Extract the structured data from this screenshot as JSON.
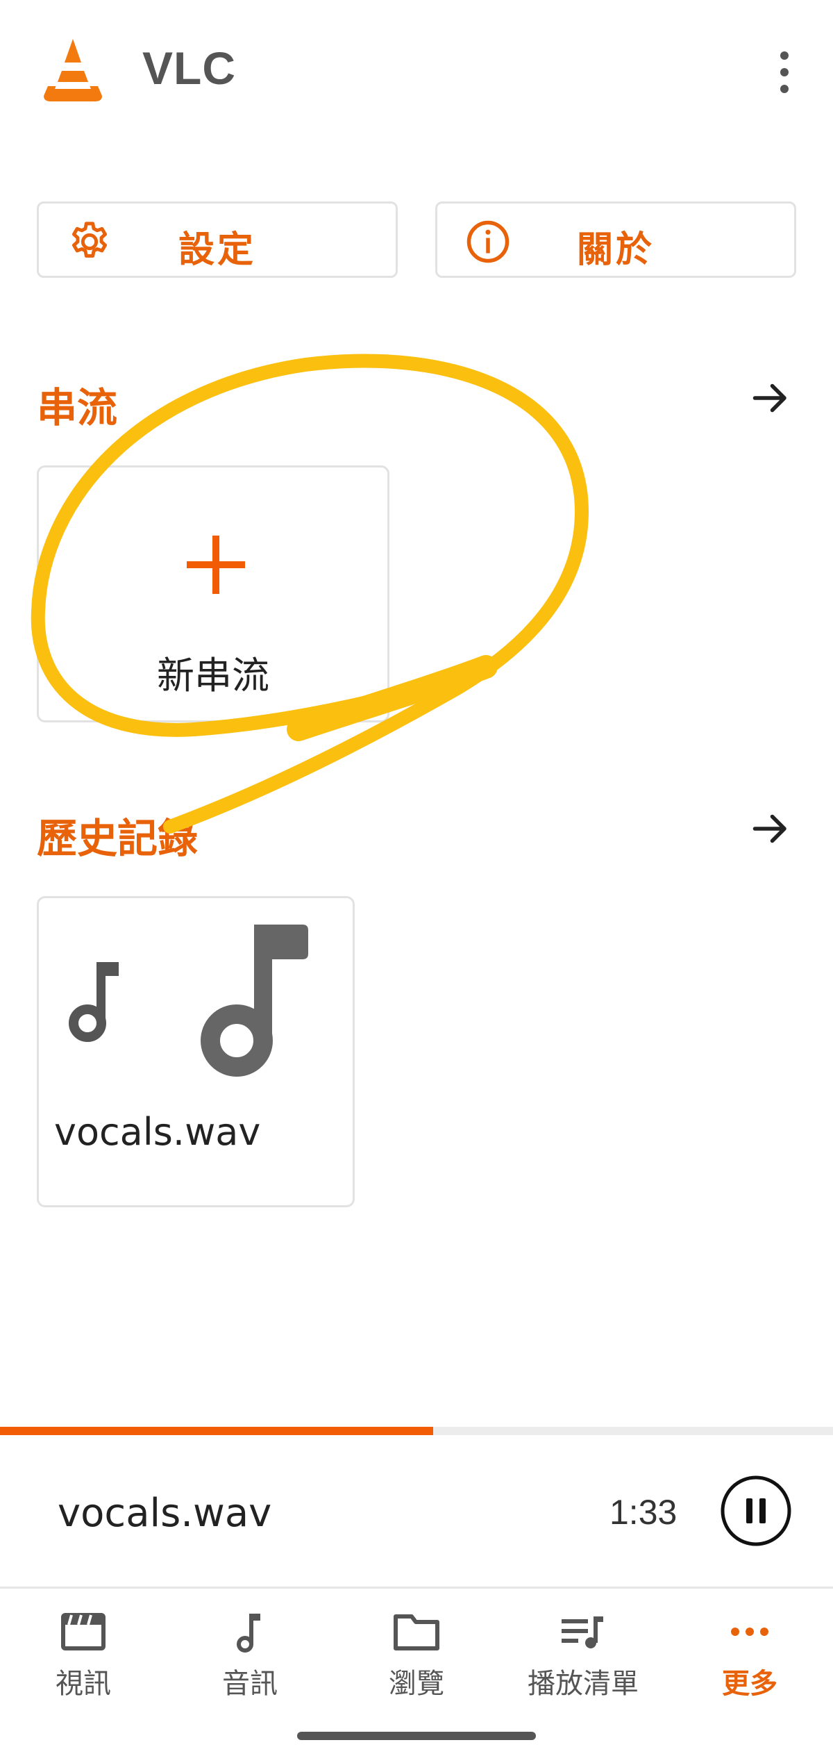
{
  "app": {
    "title": "VLC"
  },
  "buttons": {
    "settings_label": "設定",
    "about_label": "關於"
  },
  "streams": {
    "title": "串流",
    "new_stream_label": "新串流"
  },
  "history": {
    "title": "歷史記錄",
    "items": [
      {
        "label": "vocals.wav"
      }
    ]
  },
  "player": {
    "title": "vocals.wav",
    "time": "1:33",
    "progress": 0.52
  },
  "nav": {
    "items": [
      {
        "label": "視訊",
        "icon": "video-icon"
      },
      {
        "label": "音訊",
        "icon": "music-note-icon"
      },
      {
        "label": "瀏覽",
        "icon": "folder-icon"
      },
      {
        "label": "播放清單",
        "icon": "playlist-icon"
      },
      {
        "label": "更多",
        "icon": "more-dots-icon",
        "active": true
      }
    ]
  },
  "colors": {
    "accent": "#e8620a",
    "annotation": "#fbbf0f",
    "text": "#222222",
    "border": "#e2e2e2"
  }
}
